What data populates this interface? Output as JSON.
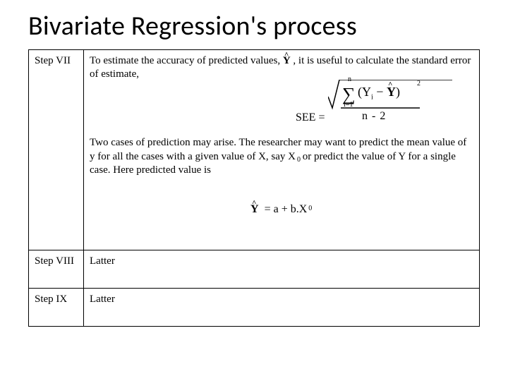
{
  "title": "Bivariate Regression's process",
  "rows": {
    "vii": {
      "step": "Step VII",
      "para1a": "To estimate the accuracy of predicted values, ",
      "yhat1": "Y",
      "para1b": ", it is useful to calculate the standard error of estimate,",
      "see_label": "SEE =",
      "sigma_top": "n",
      "sigma_bottom": "i=1",
      "paren_piece_a": "(Y",
      "paren_sub_i": "i",
      "paren_piece_b": " − ",
      "paren_yhat": "Y",
      "paren_piece_c": ")",
      "sq_exp": "2",
      "denom": "n - 2",
      "para2a": "Two cases of prediction may arise. The researcher may want to predict the mean value of y for all the cases with a given value of X, say ",
      "x0": "X",
      "x0_sub": "0",
      "para2b": "or predict the value of Y for a single case. Here predicted value is",
      "eq2_lhs": "Y",
      "eq2_rhs_a": " = a + b.X",
      "eq2_sub": "0"
    },
    "viii": {
      "step": "Step VIII",
      "body": "Latter"
    },
    "ix": {
      "step": "Step IX",
      "body": "Latter"
    }
  }
}
